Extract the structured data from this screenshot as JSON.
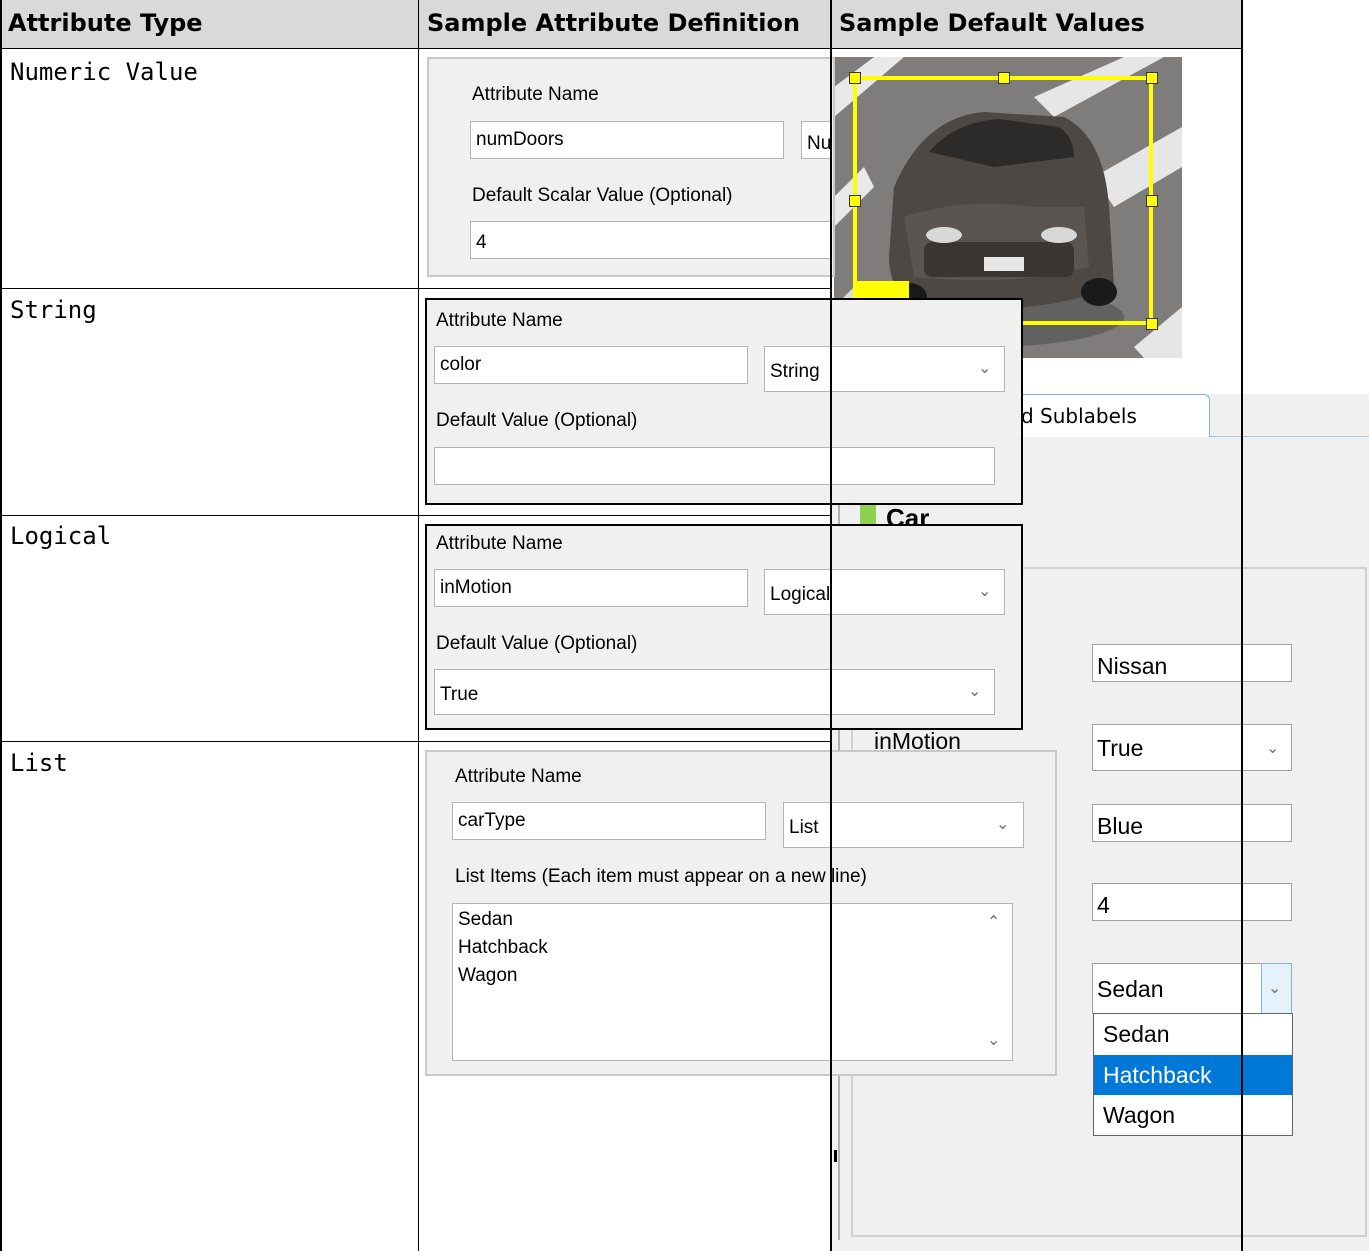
{
  "table": {
    "headers": [
      "Attribute Type",
      "Sample Attribute Definition",
      "Sample Default Values"
    ],
    "rows": [
      {
        "type": "Numeric Value"
      },
      {
        "type": "String"
      },
      {
        "type": "Logical"
      },
      {
        "type": "List"
      }
    ]
  },
  "numeric_panel": {
    "name_label": "Attribute Name",
    "name_value": "numDoors",
    "type_value": "Nu",
    "default_label": "Default Scalar Value (Optional)",
    "default_value": "4"
  },
  "string_panel": {
    "name_label": "Attribute Name",
    "name_value": "color",
    "type_value": "String",
    "default_label": "Default Value (Optional)",
    "default_value": ""
  },
  "logical_panel": {
    "name_label": "Attribute Name",
    "name_value": "inMotion",
    "type_value": "Logical",
    "default_label": "Default Value (Optional)",
    "default_value": "True"
  },
  "list_panel": {
    "name_label": "Attribute Name",
    "name_value": "carType",
    "type_value": "List",
    "items_label": "List Items (Each item must appear on a new line)",
    "items": [
      "Sedan",
      "Hatchback",
      "Wagon"
    ]
  },
  "defaults_panel": {
    "tab_label": "d Sublabels",
    "label_name": "Car",
    "label_color": "#8fd14f",
    "inmotion_label": "inMotion",
    "make_value": "Nissan",
    "inmotion_value": "True",
    "color_value": "Blue",
    "numdoors_value": "4",
    "cartype_value": "Sedan",
    "cartype_options": [
      "Sedan",
      "Hatchback",
      "Wagon"
    ],
    "selected_option": "Hatchback",
    "selection_color": "#0078d7"
  },
  "image": {
    "box_color": "#ffff00"
  }
}
